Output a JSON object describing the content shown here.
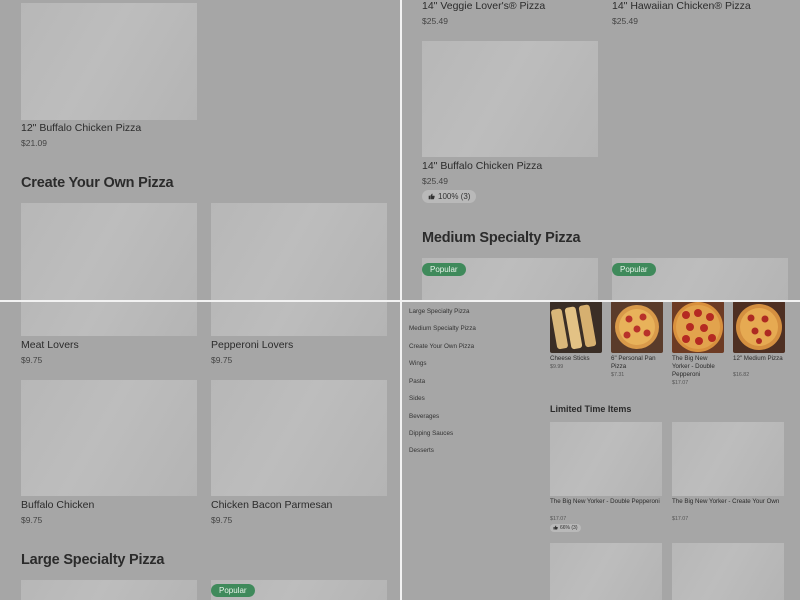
{
  "top_left": {
    "item_buffalo_12": {
      "title": "12\" Buffalo Chicken Pizza",
      "price": "$21.09"
    },
    "section_create": "Create Your Own Pizza"
  },
  "top_right": {
    "item_veggie": {
      "title": "14\" Veggie Lover's® Pizza",
      "price": "$25.49"
    },
    "item_hawaiian": {
      "title": "14\" Hawaiian Chicken® Pizza",
      "price": "$25.49"
    },
    "item_buffalo_14": {
      "title": "14\" Buffalo Chicken Pizza",
      "price": "$25.49",
      "rating": "100% (3)"
    },
    "section_medium": "Medium Specialty Pizza",
    "badge_1": "Popular",
    "badge_2": "Popular"
  },
  "bottom_left": {
    "item_meat": {
      "title": "Meat Lovers",
      "price": "$9.75"
    },
    "item_pepperoni": {
      "title": "Pepperoni Lovers",
      "price": "$9.75"
    },
    "item_buffalo": {
      "title": "Buffalo Chicken",
      "price": "$9.75"
    },
    "item_cbp": {
      "title": "Chicken Bacon Parmesan",
      "price": "$9.75"
    },
    "section_large": "Large Specialty Pizza",
    "badge": "Popular"
  },
  "bottom_right": {
    "nav": [
      "Large Specialty Pizza",
      "Medium Specialty Pizza",
      "Create Your Own Pizza",
      "Wings",
      "Pasta",
      "Sides",
      "Beverages",
      "Dipping Sauces",
      "Desserts"
    ],
    "featured": [
      {
        "title": "Cheese Sticks",
        "price": "$9.99"
      },
      {
        "title": "6\" Personal Pan Pizza",
        "price": "$7.31"
      },
      {
        "title": "The Big New Yorker - Double Pepperoni",
        "price": "$17.07"
      },
      {
        "title": "12\" Medium Pizza",
        "price": "$16.82"
      }
    ],
    "section_limited": "Limited Time Items",
    "limited": [
      {
        "title": "The Big New Yorker - Double Pepperoni",
        "price": "$17.07",
        "rating": "66% (3)"
      },
      {
        "title": "The Big New Yorker - Create Your Own",
        "price": "$17.07"
      }
    ]
  },
  "colors": {
    "badge_green": "#3f8a5b",
    "overlay_gray": "#a6a6a6",
    "divider": "#f2f2f2"
  },
  "icons": [
    "thumbs-up-icon"
  ]
}
